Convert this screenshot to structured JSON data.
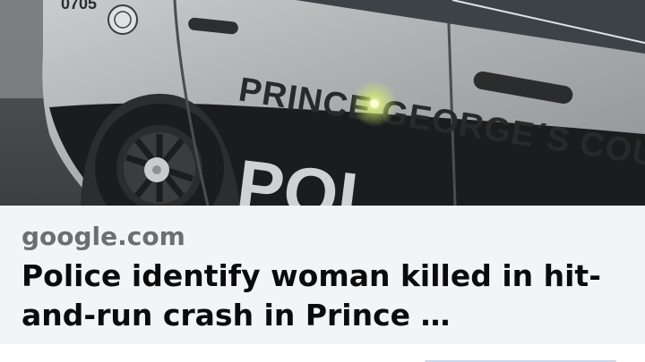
{
  "link_preview": {
    "image_text": {
      "door_lettering": "PRINCE GEORGE´S COUN",
      "panel_lettering": "POL",
      "unit_number": "0705"
    },
    "domain": "google.com",
    "headline": "Police identify woman killed in hit-and-run crash in Prince …"
  }
}
